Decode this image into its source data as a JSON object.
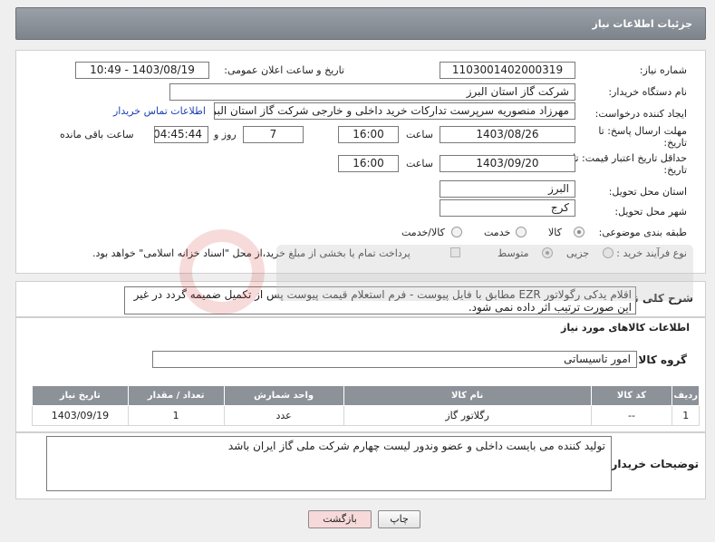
{
  "header": {
    "title": "جزئیات اطلاعات نیاز"
  },
  "fields": {
    "need_number": {
      "label": "شماره نیاز:",
      "value": "1103001402000319"
    },
    "announce": {
      "label": "تاریخ و ساعت اعلان عمومی:",
      "value": "1403/08/19 - 10:49"
    },
    "buyer_org": {
      "label": "نام دستگاه خریدار:",
      "value": "شرکت گاز استان البرز"
    },
    "requester": {
      "label": "ایجاد کننده درخواست:",
      "value": "مهرزاد منصوریه سرپرست تدارکات خرید داخلی و خارجی شرکت گاز استان البرز",
      "contact_link": "اطلاعات تماس خریدار"
    },
    "deadline": {
      "label_line1": "مهلت ارسال پاسخ: تا",
      "label_line2": "تاریخ:",
      "date": "1403/08/26",
      "time_label": "ساعت",
      "time": "16:00",
      "days": "7",
      "days_label": "روز و",
      "remaining": "04:45:44",
      "remaining_label": "ساعت باقی مانده"
    },
    "price_validity": {
      "label_line1": "حداقل تاریخ اعتبار قیمت: تا",
      "label_line2": "تاریخ:",
      "date": "1403/09/20",
      "time_label": "ساعت",
      "time": "16:00"
    },
    "province": {
      "label": "استان محل تحویل:",
      "value": "البرز"
    },
    "city": {
      "label": "شهر محل تحویل:",
      "value": "کرج"
    },
    "category": {
      "label": "طبقه بندی موضوعی:",
      "options": [
        "کالا",
        "خدمت",
        "کالا/خدمت"
      ],
      "selected": "کالا"
    },
    "process": {
      "label": "نوع فرآیند خرید :",
      "options": [
        "جزیی",
        "متوسط"
      ],
      "selected": "متوسط",
      "payment_note": "پرداخت تمام یا بخشی از مبلغ خرید،از محل \"اسناد خزانه اسلامی\" خواهد بود."
    }
  },
  "description": {
    "label": "شرح کلی نیاز:",
    "text": "اقلام یدکی رگولاتور EZR مطابق با فایل پیوست - فرم استعلام قیمت پیوست پس از تکمیل ضمیمه گردد در غیر این صورت ترتیب اثر داده نمی شود."
  },
  "goods_section": {
    "title": "اطلاعات کالاهای مورد نیاز"
  },
  "goods_group": {
    "label": "گروه کالا:",
    "value": "امور تاسیساتی"
  },
  "table": {
    "headers": [
      "ردیف",
      "کد کالا",
      "نام کالا",
      "واحد شمارش",
      "تعداد / مقدار",
      "تاریخ نیاز"
    ],
    "rows": [
      [
        "1",
        "--",
        "رگلاتور گاز",
        "عدد",
        "1",
        "1403/09/19"
      ]
    ]
  },
  "buyer_notes": {
    "label": "توضیحات خریدار:",
    "text": "تولید کننده می بایست داخلی و عضو وندور لیست چهارم شرکت ملی گاز ایران باشد"
  },
  "buttons": {
    "print": "چاپ",
    "back": "بازگشت"
  },
  "colors": {
    "header": "#8d9299",
    "link": "#1a3fb5",
    "back_button_bg": "#f7d9d9"
  }
}
